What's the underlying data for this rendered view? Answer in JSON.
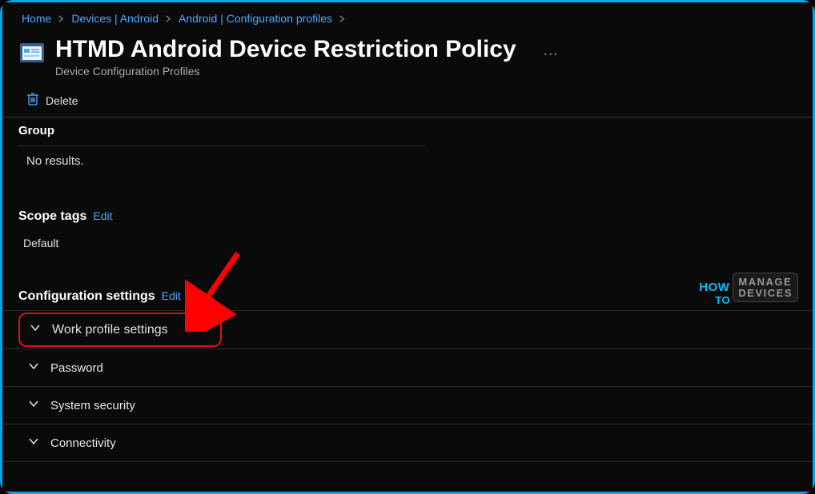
{
  "breadcrumb": {
    "items": [
      "Home",
      "Devices | Android",
      "Android | Configuration profiles"
    ]
  },
  "header": {
    "title": "HTMD Android Device Restriction Policy",
    "subtitle": "Device Configuration Profiles"
  },
  "toolbar": {
    "delete_label": "Delete"
  },
  "group": {
    "label": "Group",
    "no_results": "No results."
  },
  "scope_tags": {
    "label": "Scope tags",
    "edit": "Edit",
    "value": "Default"
  },
  "config": {
    "label": "Configuration settings",
    "edit": "Edit",
    "items": [
      {
        "label": "Work profile settings"
      },
      {
        "label": "Password"
      },
      {
        "label": "System security"
      },
      {
        "label": "Connectivity"
      }
    ]
  },
  "watermark": {
    "how": "HOW",
    "to": "TO",
    "line1": "MANAGE",
    "line2": "DEVICES"
  }
}
